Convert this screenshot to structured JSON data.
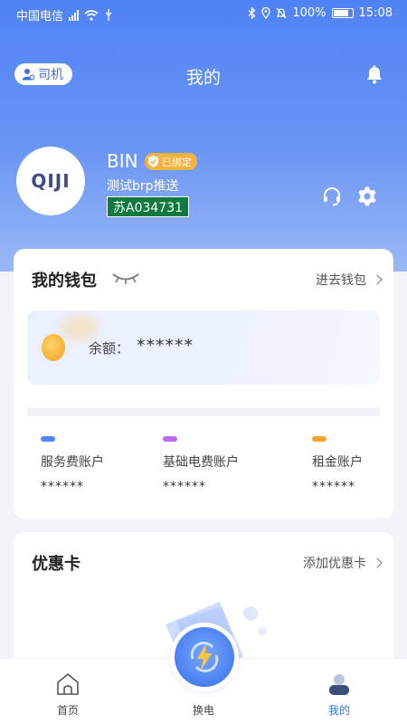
{
  "status_bar": {
    "carrier": "中国电信",
    "battery": "100%",
    "time": "15:08"
  },
  "header": {
    "role_chip": "司机",
    "title": "我的"
  },
  "profile": {
    "avatar_text": "QIJI",
    "name": "BIN",
    "bound_badge": "已绑定",
    "subtitle": "测试brp推送",
    "plate": "苏A034731"
  },
  "wallet": {
    "title": "我的钱包",
    "link": "进去钱包",
    "balance_label": "余额：",
    "balance_value": "******",
    "accounts": [
      {
        "label": "服务费账户",
        "value": "******",
        "color": "#4f86f7"
      },
      {
        "label": "基础电费账户",
        "value": "******",
        "color": "#b86af2"
      },
      {
        "label": "租金账户",
        "value": "******",
        "color": "#f5a42a"
      }
    ]
  },
  "coupon": {
    "title": "优惠卡",
    "link": "添加优惠卡"
  },
  "bottom_nav": {
    "home": "首页",
    "swap": "换电",
    "mine": "我的"
  },
  "colors": {
    "primary": "#3a6ff0",
    "hero": "#4f82f5",
    "plate_green": "#0f7a3f",
    "badge_orange": "#f7b23d"
  }
}
